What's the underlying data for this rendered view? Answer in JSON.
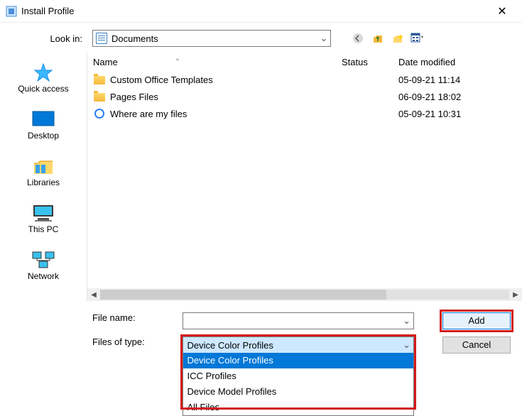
{
  "window": {
    "title": "Install Profile"
  },
  "lookin": {
    "label": "Look in:",
    "value": "Documents"
  },
  "columns": {
    "name": "Name",
    "status": "Status",
    "date": "Date modified"
  },
  "files": [
    {
      "name": "Custom Office Templates",
      "status": "",
      "date": "05-09-21 11:14",
      "type": "folder"
    },
    {
      "name": "Pages Files",
      "status": "",
      "date": "06-09-21 18:02",
      "type": "folder"
    },
    {
      "name": "Where are my files",
      "status": "",
      "date": "05-09-21 10:31",
      "type": "link"
    }
  ],
  "places": {
    "quick_access": "Quick access",
    "desktop": "Desktop",
    "libraries": "Libraries",
    "this_pc": "This PC",
    "network": "Network"
  },
  "filename": {
    "label": "File name:",
    "value": ""
  },
  "filetype": {
    "label": "Files of type:",
    "value": "Device Color Profiles",
    "options": [
      "Device Color Profiles",
      "ICC Profiles",
      "Device Model Profiles",
      "All Files"
    ]
  },
  "buttons": {
    "add": "Add",
    "cancel": "Cancel"
  }
}
